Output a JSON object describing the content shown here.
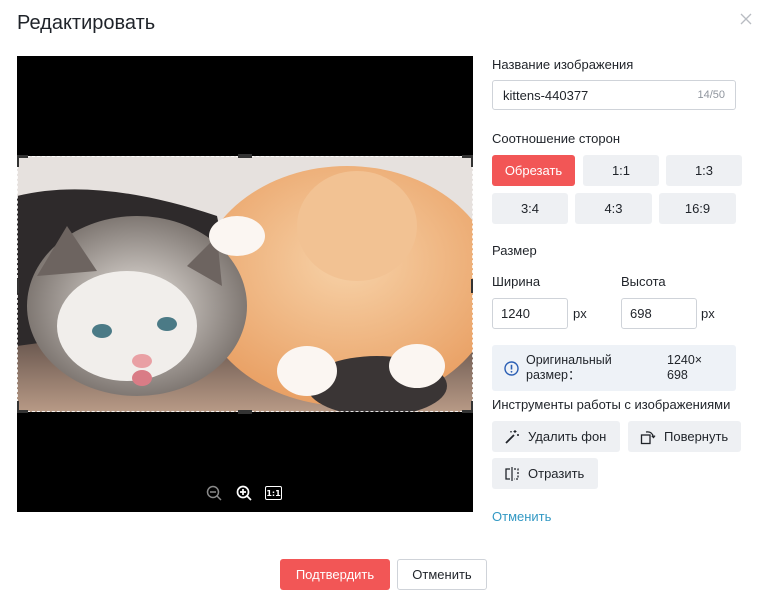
{
  "dialog": {
    "title": "Редактировать",
    "close_icon": "close-icon"
  },
  "editor": {
    "zoom_out_icon": "zoom-out-icon",
    "zoom_in_icon": "zoom-in-icon",
    "actual_size_label": "1:1"
  },
  "panel": {
    "name_label": "Название изображения",
    "name_value": "kittens-440377",
    "name_counter": "14/50",
    "ratio_label": "Соотношение сторон",
    "ratios": [
      "Обрезать",
      "1:1",
      "1:3",
      "3:4",
      "4:3",
      "16:9"
    ],
    "size_label": "Размер",
    "width_label": "Ширина",
    "height_label": "Высота",
    "width_value": "1240",
    "height_value": "698",
    "unit": "px",
    "original_label": "Оригинальный размер：",
    "original_value": "1240× 698",
    "tools_label": "Инструменты работы с изображениями",
    "tools": {
      "remove_bg": "Удалить фон",
      "rotate": "Повернуть",
      "flip": "Отразить"
    },
    "cancel_link": "Отменить"
  },
  "footer": {
    "confirm": "Подтвердить",
    "cancel": "Отменить"
  },
  "colors": {
    "accent": "#f25656",
    "link": "#3399c4"
  }
}
